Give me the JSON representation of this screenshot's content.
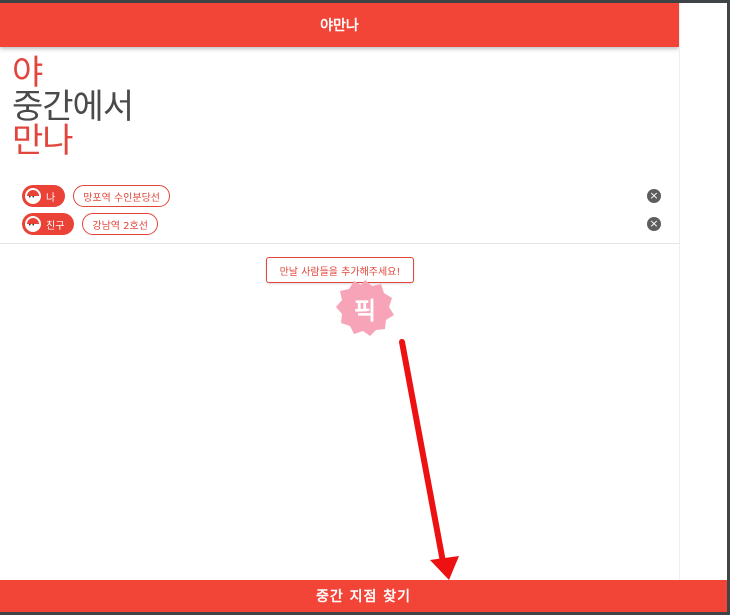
{
  "header": {
    "title": "야만나"
  },
  "hero": {
    "line1": "야",
    "line2": "중간에서",
    "line3": "만나"
  },
  "people": [
    {
      "name": "나",
      "station": "망포역 수인분당선",
      "remove_icon": "close-circle-icon"
    },
    {
      "name": "친구",
      "station": "강남역 2호선",
      "remove_icon": "close-circle-icon"
    }
  ],
  "add_people_label": "만날 사람들을 추가해주세요!",
  "pick_badge": {
    "label": "픽",
    "color": "#f7a4b8"
  },
  "annotation": {
    "type": "arrow",
    "color": "#ee1111"
  },
  "bottom_button": {
    "label": "중간 지점 찾기"
  },
  "colors": {
    "accent": "#f24437",
    "chip": "#ea4236",
    "text_dark": "#4a4a4a"
  }
}
